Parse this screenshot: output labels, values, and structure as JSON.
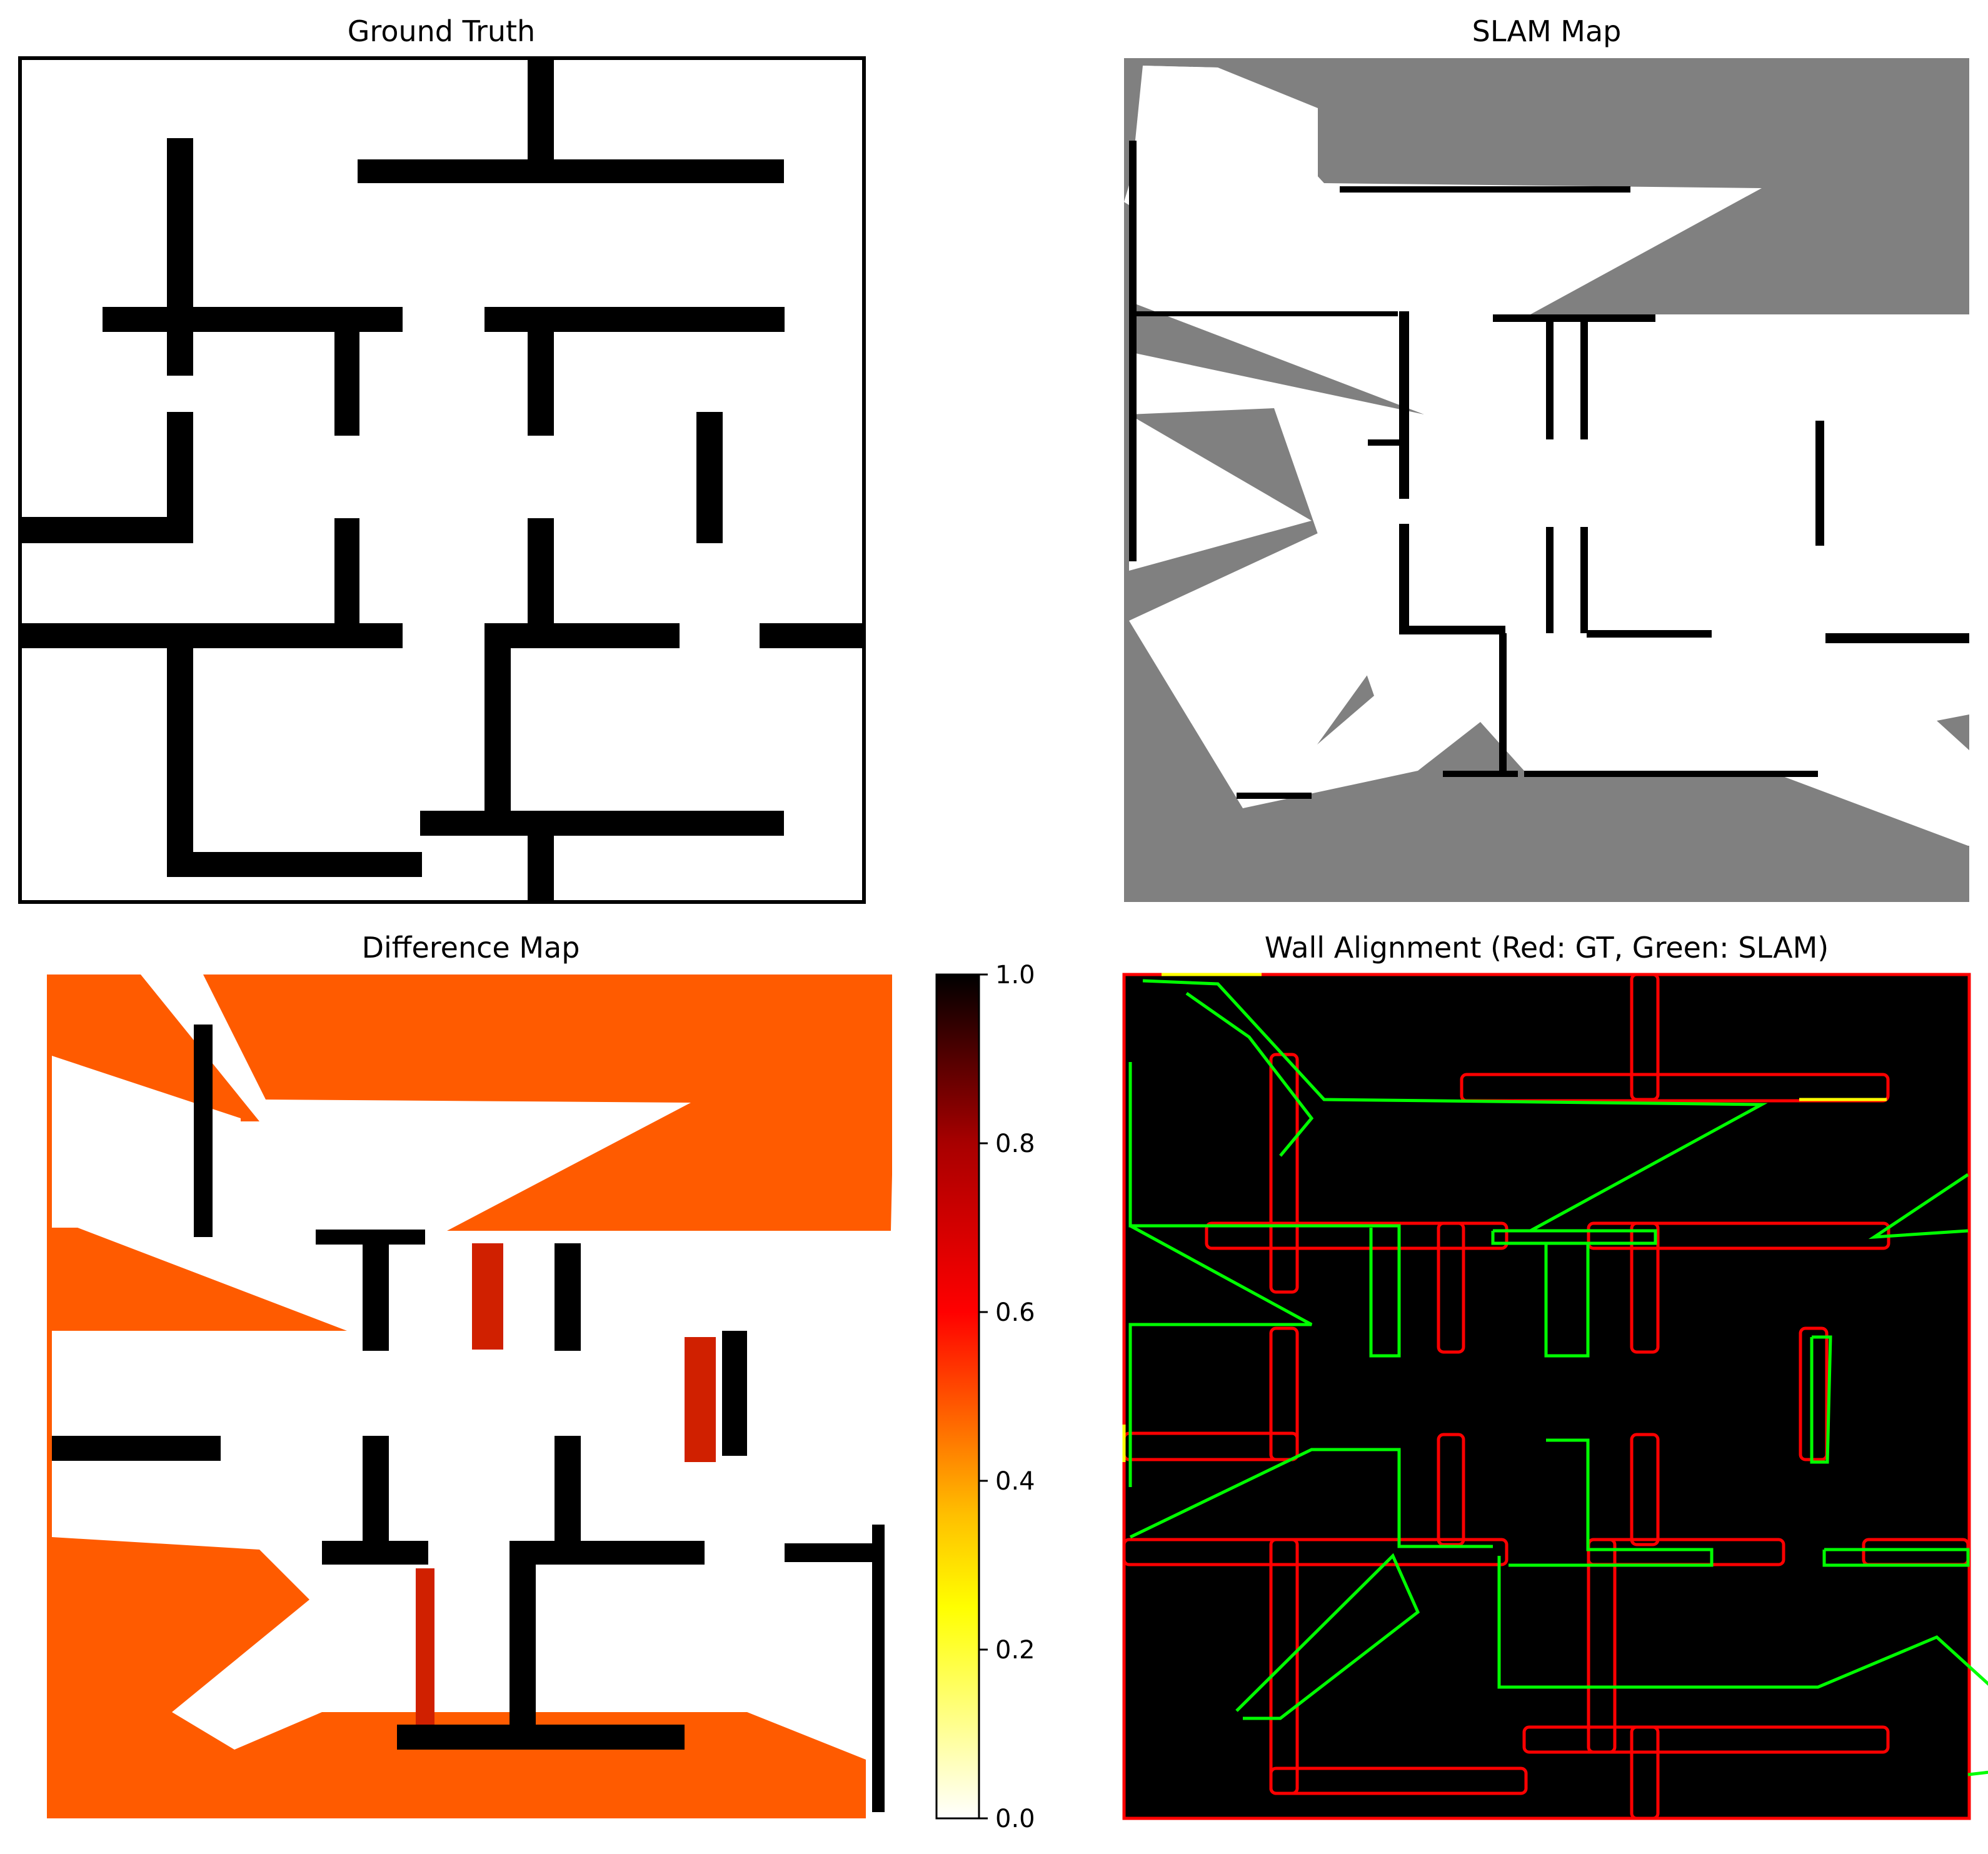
{
  "figure": {
    "background": "#ffffff"
  },
  "chart_data": [
    {
      "type": "heatmap",
      "title": "Ground Truth",
      "description": "binary occupancy grid: walls black, free space white",
      "colors": {
        "wall": "#000000",
        "free": "#ffffff"
      },
      "axes_visible": false,
      "border": true
    },
    {
      "type": "heatmap",
      "title": "SLAM Map",
      "description": "occupancy grid: occupied black, free white, unknown gray",
      "colors": {
        "occupied": "#000000",
        "free": "#ffffff",
        "unknown": "#808080"
      },
      "axes_visible": false
    },
    {
      "type": "heatmap",
      "title": "Difference Map",
      "colormap": "hot_r",
      "colorbar": {
        "range": [
          0.0,
          1.0
        ],
        "ticks": [
          0.0,
          0.2,
          0.4,
          0.6,
          0.8,
          1.0
        ],
        "tick_labels": [
          "0.0",
          "0.2",
          "0.4",
          "0.6",
          "0.8",
          "1.0"
        ],
        "placement": "right"
      },
      "dominant_values": {
        "unknown_region": 0.5,
        "agreement": 0.0,
        "disagreement": 1.0
      },
      "axes_visible": false
    },
    {
      "type": "heatmap",
      "title": "Wall Alignment (Red: GT, Green: SLAM)",
      "description": "wall contours overlaid on black background; yellow where both overlap",
      "colors": {
        "background": "#000000",
        "gt_contour": "#ff0000",
        "slam_contour": "#00ff00",
        "overlap": "#ffff00"
      },
      "axes_visible": false
    }
  ]
}
